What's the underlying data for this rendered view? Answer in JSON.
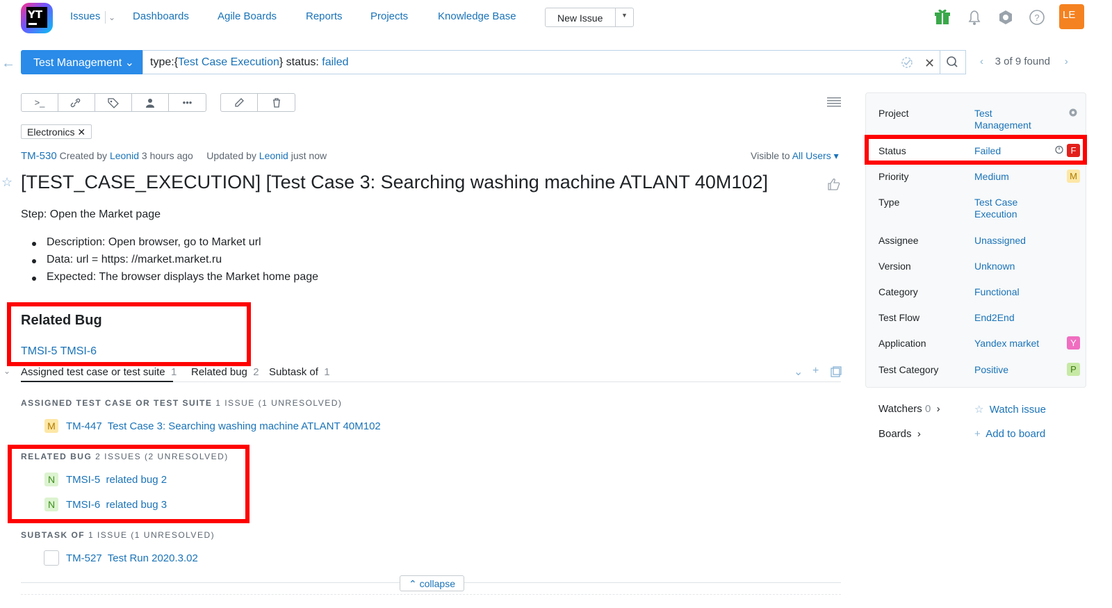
{
  "header": {
    "logo_text": "YT",
    "nav": {
      "issues": "Issues",
      "dashboards": "Dashboards",
      "agile_boards": "Agile Boards",
      "reports": "Reports",
      "projects": "Projects",
      "knowledge_base": "Knowledge Base"
    },
    "new_issue": "New Issue",
    "avatar_initials": "LE",
    "icons": [
      "gift-icon",
      "bell-icon",
      "hub-icon",
      "help-icon"
    ]
  },
  "search": {
    "project_button": "Test Management ⌄",
    "query_prefix": "type:{",
    "query_type": "Test Case Execution",
    "query_mid": "}  status: ",
    "query_status": "failed",
    "found_text": "3 of 9 found"
  },
  "tag": "Electronics ✕",
  "issue": {
    "id": "TM-530",
    "created_prefix": "Created by",
    "created_by": "Leonid",
    "created_when": "3 hours ago",
    "updated_prefix": "Updated by",
    "updated_by": "Leonid",
    "updated_when": "just now",
    "visible_prefix": "Visible to",
    "visible_to": "All Users ▾",
    "title": "[TEST_CASE_EXECUTION] [Test Case 3: Searching washing machine ATLANT 40M102]",
    "step": "Step: Open the Market page",
    "bullets": [
      "Description: Open browser, go to Market url",
      "Data: url = https: //market.market.ru",
      "Expected: The browser displays the Market home page"
    ],
    "related_bug_heading": "Related Bug",
    "related_bug_links": "TMSI-5 TMSI-6"
  },
  "tabs": [
    {
      "label": "Assigned test case or test suite",
      "count": "1"
    },
    {
      "label": "Related bug",
      "count": "2"
    },
    {
      "label": "Subtask of",
      "count": "1"
    }
  ],
  "links": {
    "assigned": {
      "heading": "ASSIGNED TEST CASE OR TEST SUITE",
      "sub": "1 ISSUE (1 UNRESOLVED)",
      "items": [
        {
          "badge": "M",
          "id": "TM-447",
          "summary": "Test Case 3: Searching washing machine ATLANT 40M102"
        }
      ]
    },
    "related": {
      "heading": "RELATED BUG",
      "sub": "2 ISSUES (2 UNRESOLVED)",
      "items": [
        {
          "badge": "N",
          "id": "TMSI-5",
          "summary": "related bug 2"
        },
        {
          "badge": "N",
          "id": "TMSI-6",
          "summary": "related bug 3"
        }
      ]
    },
    "subtask": {
      "heading": "SUBTASK OF",
      "sub": "1 ISSUE (1 UNRESOLVED)",
      "items": [
        {
          "badge": "",
          "id": "TM-527",
          "summary": "Test Run 2020.3.02"
        }
      ]
    },
    "collapse": "⌃ collapse"
  },
  "fields": [
    {
      "label": "Project",
      "value": "Test\nManagement"
    },
    {
      "label": "Status",
      "value": "Failed",
      "badge": "F"
    },
    {
      "label": "Priority",
      "value": "Medium",
      "badge": "M"
    },
    {
      "label": "Type",
      "value": "Test Case\nExecution"
    },
    {
      "label": "Assignee",
      "value": "Unassigned"
    },
    {
      "label": "Version",
      "value": "Unknown"
    },
    {
      "label": "Category",
      "value": "Functional"
    },
    {
      "label": "Test Flow",
      "value": "End2End"
    },
    {
      "label": "Application",
      "value": "Yandex market",
      "badge": "Y"
    },
    {
      "label": "Test Category",
      "value": "Positive",
      "badge": "P"
    }
  ],
  "watchers": {
    "label": "Watchers",
    "count": "0",
    "action": "Watch issue"
  },
  "boards": {
    "label": "Boards",
    "action": "Add to board"
  },
  "colors": {
    "accent": "#2a8be8",
    "link": "#1a73b8",
    "highlight": "#ff0000",
    "status_failed": "#e3211c",
    "priority_medium": "#fde7a6",
    "state_new": "#dcf3d0",
    "app_yandex": "#f06ec0",
    "positive": "#c7e9a6"
  }
}
